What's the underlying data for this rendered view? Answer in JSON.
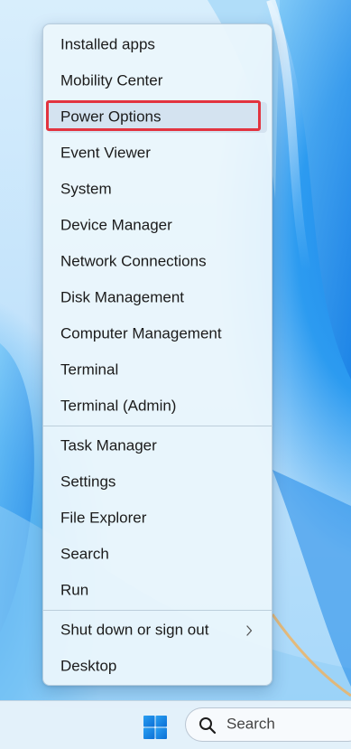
{
  "menu": {
    "group1": [
      {
        "label": "Installed apps"
      },
      {
        "label": "Mobility Center"
      },
      {
        "label": "Power Options"
      },
      {
        "label": "Event Viewer"
      },
      {
        "label": "System"
      },
      {
        "label": "Device Manager"
      },
      {
        "label": "Network Connections"
      },
      {
        "label": "Disk Management"
      },
      {
        "label": "Computer Management"
      },
      {
        "label": "Terminal"
      },
      {
        "label": "Terminal (Admin)"
      }
    ],
    "group2": [
      {
        "label": "Task Manager"
      },
      {
        "label": "Settings"
      },
      {
        "label": "File Explorer"
      },
      {
        "label": "Search"
      },
      {
        "label": "Run"
      }
    ],
    "group3": [
      {
        "label": "Shut down or sign out"
      },
      {
        "label": "Desktop"
      }
    ],
    "highlighted_item": "Power Options",
    "highlight_color": "#e2343f",
    "submenu_icon": "chevron-right-icon"
  },
  "taskbar": {
    "start_icon": "windows-logo-icon",
    "search_placeholder": "Search",
    "search_icon": "search-icon",
    "accent_color": "#0a6fd6"
  }
}
